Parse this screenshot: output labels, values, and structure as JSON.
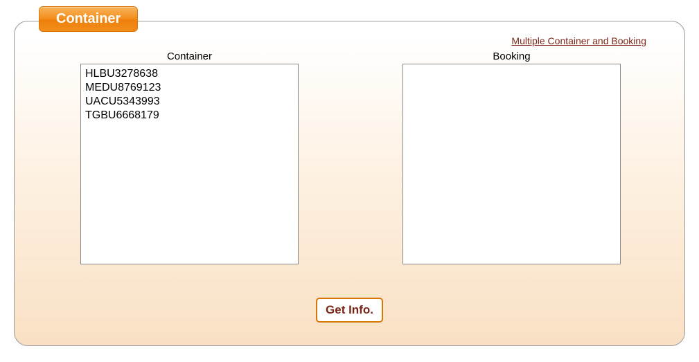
{
  "panel": {
    "title": "Container",
    "multiple_link": "Multiple Container and Booking",
    "container_label": "Container",
    "booking_label": "Booking",
    "container_value": "HLBU3278638\nMEDU8769123\nUACU5343993\nTGBU6668179",
    "booking_value": "",
    "get_info_label": "Get Info."
  }
}
